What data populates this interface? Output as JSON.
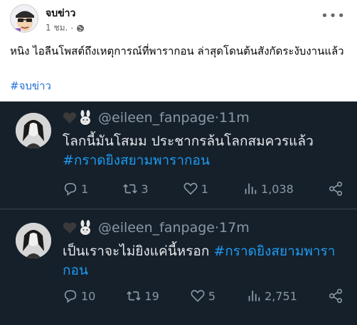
{
  "post": {
    "page_name": "จบข่าว",
    "time": "1 ชม.",
    "text": "หนิง ไอลีนโพสต์ถึงเหตุการณ์ที่พารากอน ล่าสุดโดนต้นสังกัดระงับงานแล้ว",
    "hashtag": "#จบข่าว"
  },
  "tweets": [
    {
      "handle": "@eileen_fanpage",
      "time": "11m",
      "text": "โลกนี้มันโสมม ประชากรล้นโลกสมควรแล้ว ",
      "tag": "#กราดยิงสยามพารากอน",
      "replies": "1",
      "retweets": "3",
      "likes": "1",
      "views": "1,038"
    },
    {
      "handle": "@eileen_fanpage",
      "time": "17m",
      "text": "เป็นเราจะไม่ยิงแค่นี้หรอก ",
      "tag": "#กราดยิงสยามพารากอน",
      "replies": "10",
      "retweets": "19",
      "likes": "5",
      "views": "2,751"
    }
  ],
  "sep": " · ",
  "colors": {
    "embed_bg": "#15202b",
    "link": "#1d9bf0",
    "fb_link": "#216fdb"
  }
}
